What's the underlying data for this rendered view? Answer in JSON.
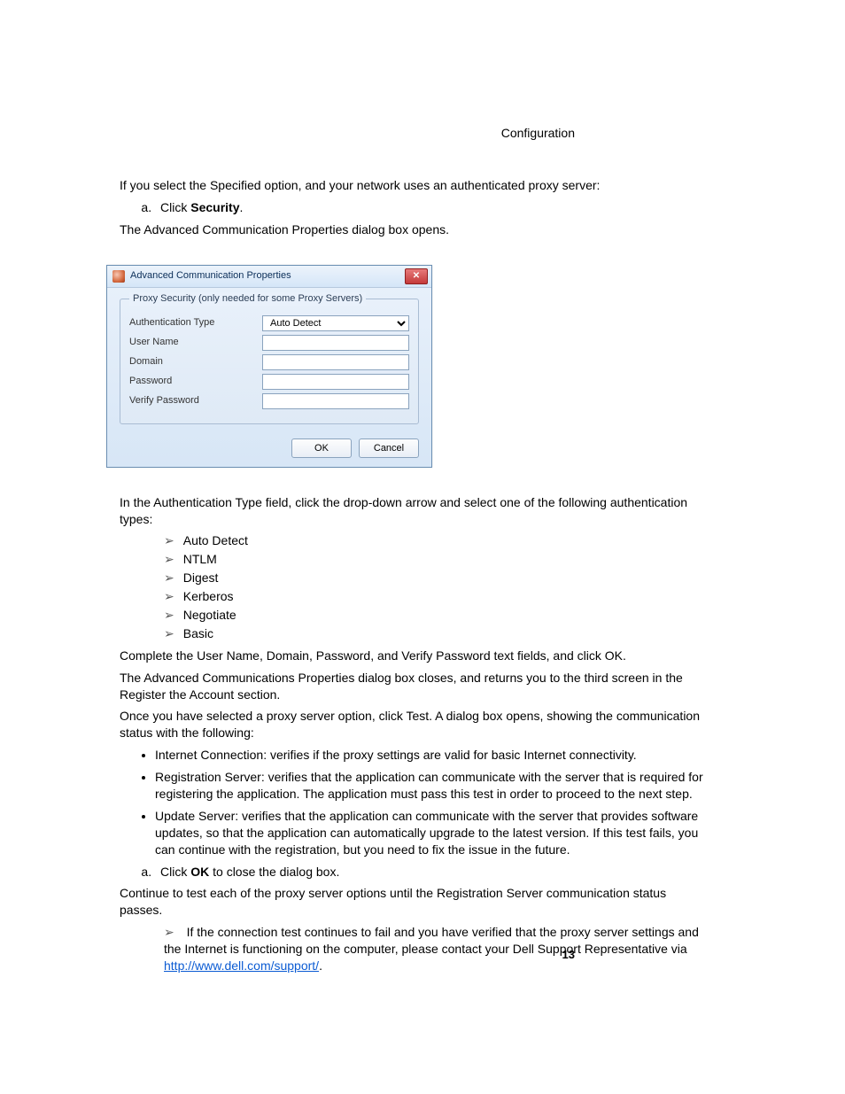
{
  "header": {
    "section": "Configuration"
  },
  "intro": {
    "line1": "If you select the Specified option, and your network uses an authenticated proxy server:",
    "step_a_prefix": "Click ",
    "step_a_bold": "Security",
    "step_a_suffix": ".",
    "line2": "The Advanced Communication Properties dialog box opens."
  },
  "dialog": {
    "title": "Advanced Communication Properties",
    "close_symbol": "✕",
    "legend": "Proxy Security (only needed for some Proxy Servers)",
    "fields": {
      "auth_type_label": "Authentication Type",
      "auth_type_value": "Auto Detect",
      "user_name_label": "User Name",
      "user_name_value": "",
      "domain_label": "Domain",
      "domain_value": "",
      "password_label": "Password",
      "password_value": "",
      "verify_password_label": "Verify Password",
      "verify_password_value": ""
    },
    "buttons": {
      "ok": "OK",
      "cancel": "Cancel"
    }
  },
  "post_dialog": {
    "line1": "In the Authentication Type field, click the drop-down arrow and select one of the following authentication types:",
    "types": [
      "Auto Detect",
      "NTLM",
      "Digest",
      "Kerberos",
      "Negotiate",
      "Basic"
    ],
    "line2": "Complete the User Name, Domain, Password, and Verify Password text fields, and click OK.",
    "line3": "The Advanced Communications Properties dialog box closes, and returns you to the third screen in the Register the Account section.",
    "line4": "Once you have selected a proxy server option, click Test. A dialog box opens, showing the communication status with the following:",
    "tests": [
      "Internet Connection: verifies if the proxy settings are valid for basic Internet connectivity.",
      "Registration Server: verifies that the application can communicate with the server that is required for registering the application. The application must pass this test in order to proceed to the next step.",
      "Update Server: verifies that the application can communicate with the server that provides software updates, so that the application can automatically upgrade to the latest version. If this test fails, you can continue with the registration, but you need to fix the issue in the future."
    ],
    "step_a2_prefix": "Click ",
    "step_a2_bold": "OK",
    "step_a2_suffix": " to close the dialog box.",
    "line5": "Continue to test each of the proxy server options until the Registration Server communication status passes.",
    "fail_prefix": "If the connection test continues to fail and you have verified that the proxy server settings and the Internet is functioning on the computer, please contact your Dell Support Representative via ",
    "fail_link_text": "http://www.dell.com/support/",
    "fail_suffix": "."
  },
  "page_number": "13"
}
